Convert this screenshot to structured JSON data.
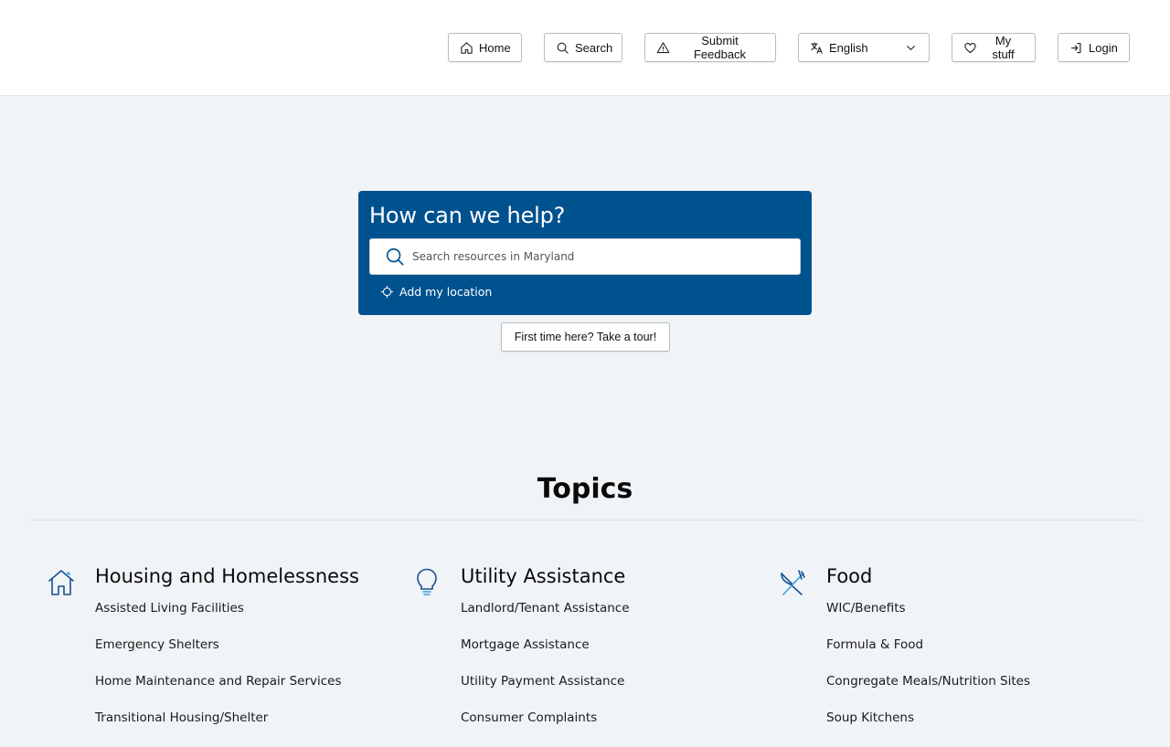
{
  "header": {
    "nav": {
      "home": "Home",
      "search": "Search",
      "feedback": "Submit Feedback",
      "language": "English",
      "my_stuff": "My stuff",
      "login": "Login"
    }
  },
  "hero": {
    "title": "How can we help?",
    "search_placeholder": "Search resources in Maryland",
    "location_link": "Add my location"
  },
  "tour_button": "First time here? Take a tour!",
  "topics": {
    "title": "Topics",
    "columns": [
      {
        "icon": "house-icon",
        "heading": "Housing and Homelessness",
        "items": [
          "Assisted Living Facilities",
          "Emergency Shelters",
          "Home Maintenance and Repair Services",
          "Transitional Housing/Shelter"
        ]
      },
      {
        "icon": "lightbulb-icon",
        "heading": "Utility Assistance",
        "items": [
          "Landlord/Tenant Assistance",
          "Mortgage Assistance",
          "Utility Payment Assistance",
          "Consumer Complaints"
        ]
      },
      {
        "icon": "fork-knife-icon",
        "heading": "Food",
        "items": [
          "WIC/Benefits",
          "Formula & Food",
          "Congregate Meals/Nutrition Sites",
          "Soup Kitchens"
        ]
      }
    ]
  },
  "colors": {
    "hero_bg": "#00528f",
    "page_bg": "#f1f4f7",
    "icon_blue": "#1a4f8f",
    "icon_accent": "#3aa0d8"
  }
}
